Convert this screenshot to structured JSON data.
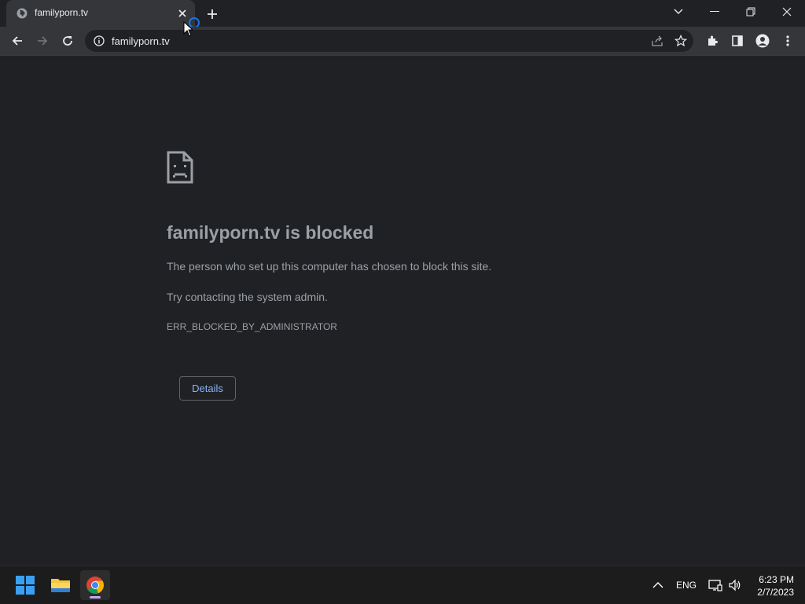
{
  "browser": {
    "tab": {
      "title": "familyporn.tv"
    },
    "address_bar": {
      "url": "familyporn.tv"
    }
  },
  "page": {
    "heading": "familyporn.tv is blocked",
    "line1": "The person who set up this computer has chosen to block this site.",
    "line2": "Try contacting the system admin.",
    "error_code": "ERR_BLOCKED_BY_ADMINISTRATOR",
    "details_label": "Details"
  },
  "taskbar": {
    "language": "ENG",
    "time": "6:23 PM",
    "date": "2/7/2023"
  },
  "colors": {
    "background": "#202124",
    "toolbar": "#35363a",
    "link_blue": "#8ab4f8",
    "muted_text": "#9aa0a6"
  }
}
